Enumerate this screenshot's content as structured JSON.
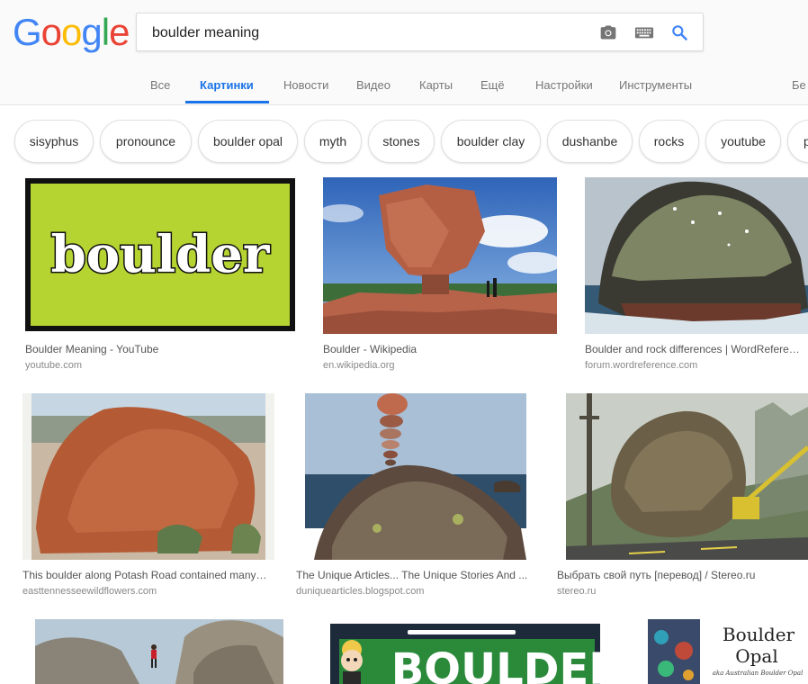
{
  "search": {
    "query": "boulder meaning"
  },
  "logo": {
    "letters": [
      {
        "ch": "G",
        "color": "#4285f4"
      },
      {
        "ch": "o",
        "color": "#ea4335"
      },
      {
        "ch": "o",
        "color": "#fbbc05"
      },
      {
        "ch": "g",
        "color": "#4285f4"
      },
      {
        "ch": "l",
        "color": "#34a853"
      },
      {
        "ch": "e",
        "color": "#ea4335"
      }
    ]
  },
  "tabs": [
    {
      "label": "Все",
      "active": false
    },
    {
      "label": "Картинки",
      "active": true
    },
    {
      "label": "Новости",
      "active": false
    },
    {
      "label": "Видео",
      "active": false
    },
    {
      "label": "Карты",
      "active": false
    },
    {
      "label": "Ещё",
      "active": false
    },
    {
      "label": "Настройки",
      "active": false
    },
    {
      "label": "Инструменты",
      "active": false
    }
  ],
  "edge_text": "Бе",
  "chips": [
    "sisyphus",
    "pronounce",
    "boulder opal",
    "myth",
    "stones",
    "boulder clay",
    "dushanbe",
    "rocks",
    "youtube",
    "p"
  ],
  "results": [
    {
      "title": "Boulder Meaning - YouTube",
      "source": "youtube.com",
      "word": "boulder"
    },
    {
      "title": "Boulder - Wikipedia",
      "source": "en.wikipedia.org"
    },
    {
      "title": "Boulder and rock differences | WordReference Forums",
      "source": "forum.wordreference.com"
    },
    {
      "title": "This boulder along Potash Road contained many ...",
      "source": "easttennesseewildflowers.com"
    },
    {
      "title": "The Unique Articles... The Unique Stories And ...",
      "source": "duniquearticles.blogspot.com"
    },
    {
      "title": "Выбрать свой путь [перевод] / Stereo.ru",
      "source": "stereo.ru"
    },
    {
      "title": "",
      "source": ""
    },
    {
      "title": "",
      "source": "",
      "word": "BOULDER"
    },
    {
      "title": "",
      "source": "",
      "word1": "Boulder",
      "word2": "Opal",
      "caption": "aka Australian Boulder Opal"
    }
  ],
  "colors": {
    "accent": "#1a73e8",
    "youtube_bg": "#b5d431"
  }
}
